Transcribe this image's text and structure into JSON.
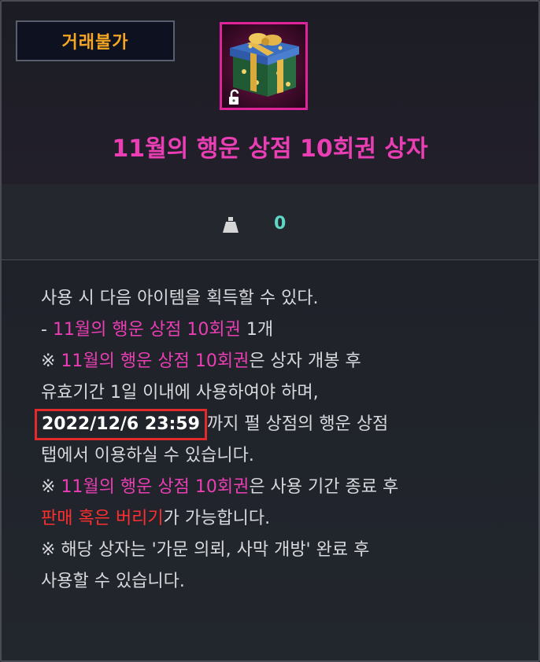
{
  "header": {
    "trade_badge": "거래불가",
    "item_title": "11월의 행운 상점 10회권 상자"
  },
  "icon": {
    "name": "gift-box-icon",
    "lock_name": "unlock-icon",
    "frame_color": "#e0239a"
  },
  "weight": {
    "icon": "weight-icon",
    "value": "0"
  },
  "description": {
    "line1": "사용 시 다음 아이템을 획득할 수 있다.",
    "line2_prefix": "- ",
    "line2_item": "11월의 행운 상점 10회권",
    "line2_suffix": " 1개",
    "line3_prefix": "※ ",
    "line3_item": "11월의 행운 상점 10회권",
    "line3_suffix": "은 상자 개봉 후",
    "line4": "유효기간 1일 이내에 사용하여야 하며,",
    "line5_date": "2022/12/6 23:59",
    "line5_suffix": "까지 펄 상점의 행운 상점",
    "line6": "탭에서 이용하실 수 있습니다.",
    "line7_prefix": "※ ",
    "line7_item": "11월의 행운 상점 10회권",
    "line7_suffix": "은 사용 기간 종료 후",
    "line8_red": "판매 혹은 버리기",
    "line8_suffix": "가 가능합니다.",
    "line9": "※ 해당 상자는 '가문 의뢰, 사막 개방'  완료 후",
    "line10": "사용할 수 있습니다."
  },
  "colors": {
    "title_pink": "#ea3eb4",
    "badge_orange": "#f5a623",
    "weight_teal": "#5fd7c6",
    "warning_red": "#ff2f2f",
    "highlight_box": "#e22a2a"
  }
}
